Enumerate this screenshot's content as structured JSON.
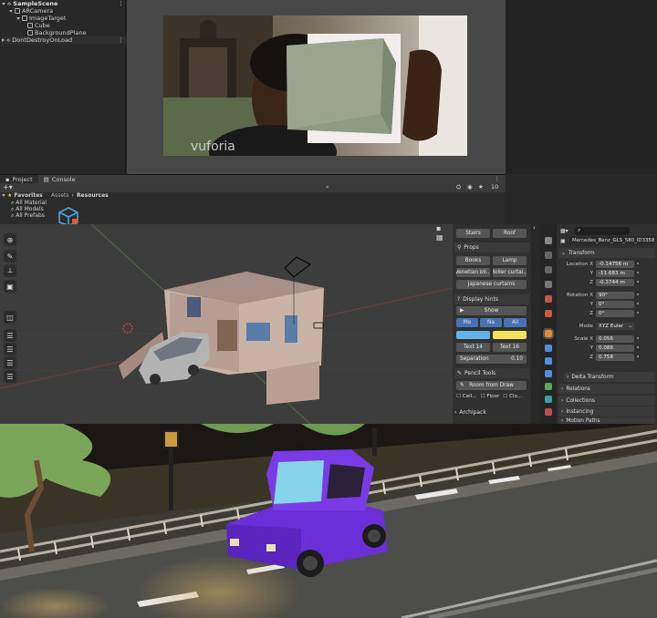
{
  "unity": {
    "hierarchy": {
      "scene": "SampleScene",
      "items": [
        "ARCamera",
        "ImageTarget",
        "Cube",
        "BackgroundPlane"
      ],
      "dont_destroy": "DontDestroyOnLoad"
    },
    "game_view": {
      "watermark": "vuforia"
    },
    "project": {
      "tabs": [
        "Project",
        "Console"
      ],
      "favorites_label": "Favorites",
      "favorites": [
        "All Material",
        "All Models",
        "All Prefabs"
      ],
      "breadcrumb": [
        "Assets",
        "Resources"
      ],
      "count_badge": "10"
    }
  },
  "blender": {
    "npanel": {
      "top_buttons": [
        "Stairs",
        "Roof"
      ],
      "props_header": "Props",
      "props": [
        "Books",
        "Lamp",
        "Venetian bli...",
        "Roller curtai...",
        "Japanese curtains"
      ],
      "display_hints_header": "Display hints",
      "show_button": "Show",
      "toggles": [
        "Me",
        "Na",
        "All"
      ],
      "text_fields": [
        {
          "label": "Text",
          "value": "14"
        },
        {
          "label": "Text",
          "value": "16"
        }
      ],
      "separation": {
        "label": "Separation",
        "value": "0.10"
      },
      "pencil_header": "Pencil Tools",
      "room_from_draw": "Room from Draw",
      "checks": [
        "Ceil...",
        "Floor",
        "Clo..."
      ],
      "archipack": "Archipack"
    },
    "properties": {
      "object_name": "Mercedes_Benz_GLS_580_ID3358",
      "transform_header": "Transform",
      "location": {
        "label": "Location",
        "x": "-0.14756 m",
        "y": "-11.683 m",
        "z": "-0.3744 m"
      },
      "rotation": {
        "label": "Rotation",
        "x": "90°",
        "y": "0°",
        "z": "0°"
      },
      "mode": {
        "label": "Mode",
        "value": "XYZ Euler"
      },
      "scale": {
        "label": "Scale",
        "x": "0.056",
        "y": "0.086",
        "z": "0.758"
      },
      "axis": [
        "X",
        "Y",
        "Z"
      ],
      "sections": [
        "Delta Transform",
        "Relations",
        "Collections",
        "Instancing",
        "Motion Paths"
      ]
    }
  },
  "colors": {
    "accent_blue": "#4772b3",
    "swatch_blue": "#5fb5ea",
    "swatch_yellow": "#f2e25a",
    "car_purple": "#6a2fd6"
  }
}
